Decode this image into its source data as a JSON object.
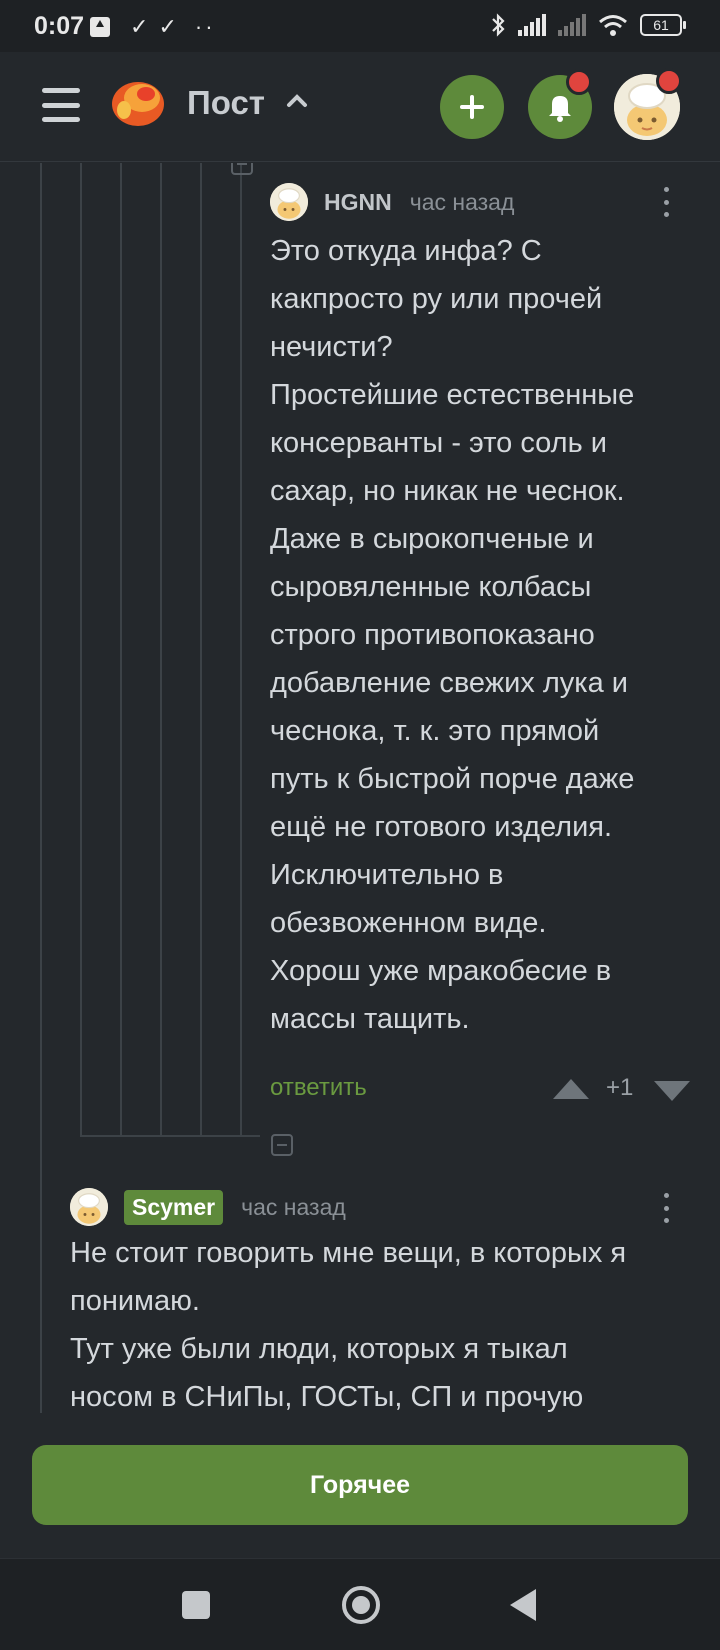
{
  "status_bar": {
    "time": "0:07",
    "battery": "61"
  },
  "header": {
    "title": "Пост"
  },
  "comments": [
    {
      "author": "HGNN",
      "time": "час назад",
      "text": "Это откуда инфа? С\nкакпросто ру или прочей\nнечисти?\nПростейшие естественные\nконсерванты - это соль и\nсахар, но никак не чеснок.\nДаже в сырокопченые и\nсыровяленные колбасы\nстрого противопоказано\nдобавление свежих лука и\nчеснока, т. к. это прямой\nпуть к быстрой порче даже\nещё не готового изделия.\nИсключительно в\nобезвоженном виде.\nХорош уже мракобесие в\nмассы тащить.",
      "reply_label": "ответить",
      "score": "+1"
    },
    {
      "author": "Scymer",
      "time": "час назад",
      "text": "Не стоит говорить мне вещи, в которых я\nпонимаю.\nТут уже были люди, которых я тыкал\nносом в СНиПы, ГОСТы, СП и прочую"
    }
  ],
  "hot_button": {
    "label": "Горячее"
  },
  "colors": {
    "background": "#24282c",
    "accent_green": "#5e8a3b",
    "notification_red": "#e0443e",
    "link_green": "#6a9a40"
  },
  "icons": [
    "hamburger-menu-icon",
    "pikabu-logo-icon",
    "chevron-up-icon",
    "plus-icon",
    "bell-icon",
    "more-vertical-icon",
    "upvote-icon",
    "downvote-icon",
    "collapse-icon"
  ]
}
